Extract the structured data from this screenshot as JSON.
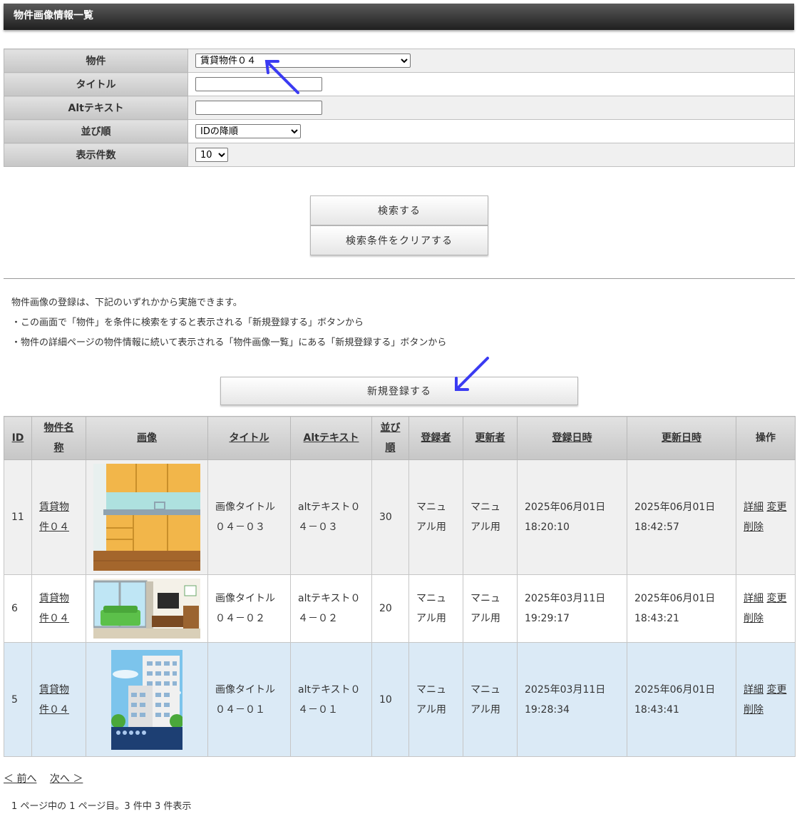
{
  "page": {
    "title": "物件画像情報一覧"
  },
  "form": {
    "rows": [
      {
        "label": "物件"
      },
      {
        "label": "タイトル"
      },
      {
        "label": "Altテキスト"
      },
      {
        "label": "並び順"
      },
      {
        "label": "表示件数"
      }
    ],
    "property_value": "賃貸物件０４",
    "title_value": "",
    "alt_value": "",
    "sort_value": "IDの降順",
    "count_value": "10"
  },
  "buttons": {
    "search": "検索する",
    "clear": "検索条件をクリアする",
    "new": "新規登録する"
  },
  "notes": [
    "物件画像の登録は、下記のいずれかから実施できます。",
    "・この画面で「物件」を条件に検索をすると表示される「新規登録する」ボタンから",
    "・物件の詳細ページの物件情報に続いて表示される「物件画像一覧」にある「新規登録する」ボタンから"
  ],
  "table": {
    "headers": {
      "id": "ID",
      "property": "物件名称",
      "image": "画像",
      "title": "タイトル",
      "alt": "Altテキスト",
      "order": "並び順",
      "registrant": "登録者",
      "updater": "更新者",
      "created": "登録日時",
      "updated": "更新日時",
      "actions": "操作"
    },
    "rows": [
      {
        "id": "11",
        "property": "賃貸物件０４",
        "image": "kitchen-image",
        "title": "画像タイトル０４－０３",
        "alt": "altテキスト０４－０３",
        "order": "30",
        "registrant": "マニュアル用",
        "updater": "マニュアル用",
        "created_date": "2025年06月01日",
        "created_time": "18:20:10",
        "updated_date": "2025年06月01日",
        "updated_time": "18:42:57",
        "detail": "詳細",
        "edit": "変更",
        "delete": "削除"
      },
      {
        "id": "6",
        "property": "賃貸物件０４",
        "image": "living-room-image",
        "title": "画像タイトル０４－０２",
        "alt": "altテキスト０４－０２",
        "order": "20",
        "registrant": "マニュアル用",
        "updater": "マニュアル用",
        "created_date": "2025年03月11日",
        "created_time": "19:29:17",
        "updated_date": "2025年06月01日",
        "updated_time": "18:43:21",
        "detail": "詳細",
        "edit": "変更",
        "delete": "削除"
      },
      {
        "id": "5",
        "property": "賃貸物件０４",
        "image": "apartment-building-image",
        "title": "画像タイトル０４－０１",
        "alt": "altテキスト０４－０１",
        "order": "10",
        "registrant": "マニュアル用",
        "updater": "マニュアル用",
        "created_date": "2025年03月11日",
        "created_time": "19:28:34",
        "updated_date": "2025年06月01日",
        "updated_time": "18:43:41",
        "detail": "詳細",
        "edit": "変更",
        "delete": "削除"
      }
    ]
  },
  "pager": {
    "prev": "＜ 前へ",
    "next": "次へ ＞",
    "info": "1 ページ中の 1 ページ目。3 件中 3 件表示"
  },
  "colors": {
    "accent_arrow": "#3b3bf2",
    "header_bar": "#2e2e2e",
    "selected_row": "#dbeaf6"
  }
}
